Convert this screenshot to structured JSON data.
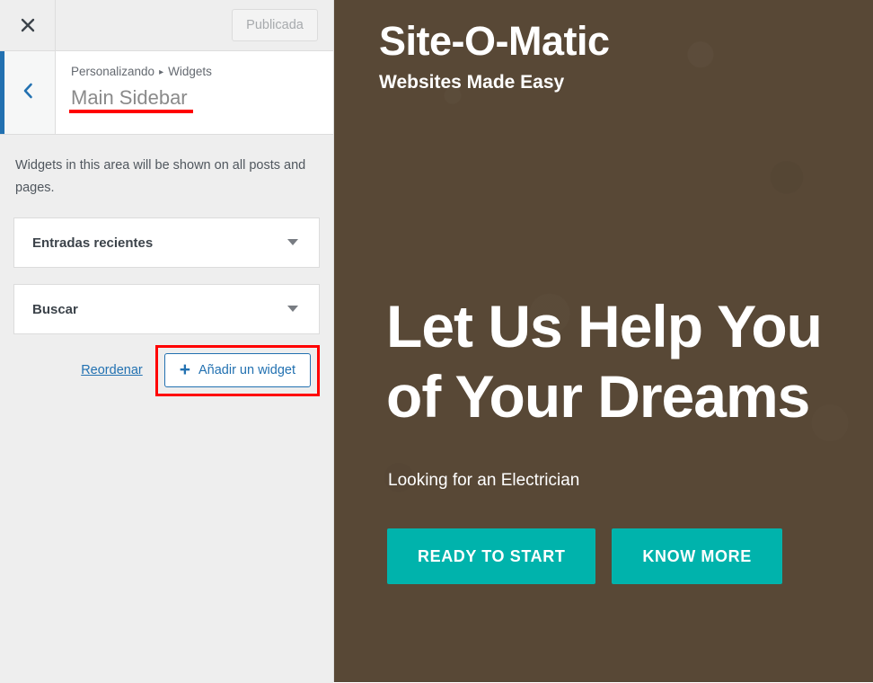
{
  "customizer": {
    "topbar": {
      "close_icon": "close-x-icon",
      "publish_button_label": "Publicada"
    },
    "panel_header": {
      "back_icon": "chevron-left-icon",
      "breadcrumb_root": "Personalizando",
      "breadcrumb_separator": "▸",
      "breadcrumb_current": "Widgets",
      "panel_title": "Main Sidebar"
    },
    "body": {
      "description": "Widgets in this area will be shown on all posts and pages.",
      "widgets": [
        {
          "title": "Entradas recientes",
          "caret_icon": "caret-down-icon"
        },
        {
          "title": "Buscar",
          "caret_icon": "caret-down-icon"
        }
      ],
      "reorder_link_label": "Reordenar",
      "add_widget_button_label": "Añadir un widget",
      "add_widget_plus_icon": "plus-icon"
    }
  },
  "preview": {
    "site_title": "Site-O-Matic",
    "site_tagline": "Websites Made Easy",
    "hero_heading_line1": "Let Us Help You",
    "hero_heading_line2": "of Your Dreams",
    "hero_subtitle": "Looking for an Electrician",
    "buttons": [
      {
        "label": "READY TO START"
      },
      {
        "label": "KNOW MORE"
      }
    ]
  },
  "colors": {
    "accent_blue": "#2271b1",
    "highlight_red": "#ff0000",
    "preview_background": "#584836",
    "cta_teal": "#00b3ac",
    "sidebar_background": "#eeeeee"
  }
}
